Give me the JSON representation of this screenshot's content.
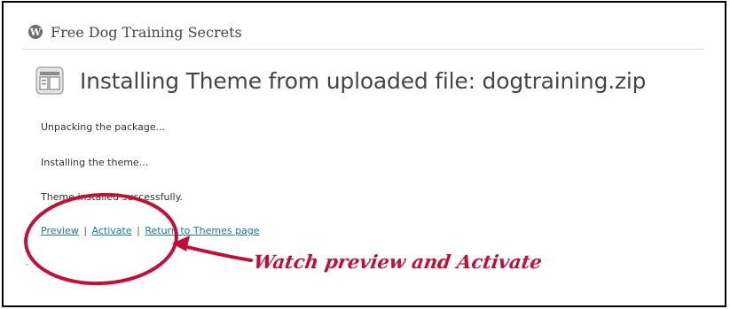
{
  "header": {
    "logo_icon": "wordpress-logo-icon",
    "logo_glyph": "W",
    "site_title": "Free Dog Training Secrets"
  },
  "main": {
    "heading_icon": "theme-layout-icon",
    "page_title": "Installing Theme from uploaded file: dogtraining.zip",
    "messages": [
      "Unpacking the package...",
      "Installing the theme...",
      "Theme installed successfully."
    ],
    "actions": {
      "preview": "Preview",
      "activate": "Activate",
      "return": "Return to Themes page",
      "separator": "|"
    }
  },
  "annotation": {
    "text": "Watch preview and Activate",
    "color": "#c0103a",
    "shapes": [
      "highlight-ellipse",
      "pointer-arrow"
    ]
  },
  "colors": {
    "link": "#21759b",
    "heading": "#464646",
    "body_text": "#333333"
  }
}
